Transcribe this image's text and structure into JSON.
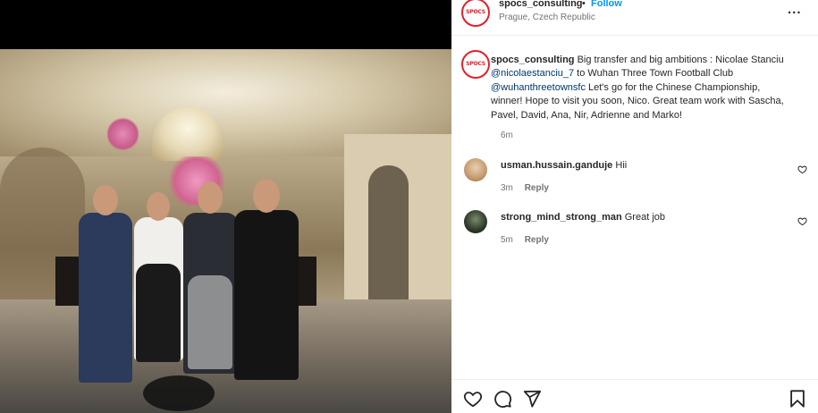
{
  "header": {
    "username": "spocs_consulting",
    "separator": "•",
    "follow_label": "Follow",
    "location": "Prague, Czech Republic",
    "more_label": "...",
    "avatar_text": "SPOCS"
  },
  "caption": {
    "username": "spocs_consulting",
    "text_1": " Big transfer and big ambitions : Nicolae Stanciu ",
    "mention_1": "@nicolaestanciu_7",
    "text_2": " to Wuhan Three Town Football Club ",
    "mention_2": "@wuhanthreetownsfc",
    "text_3": " Let's go for the Chinese Championship, winner! Hope to visit you soon, Nico. Great team work with Sascha, Pavel, David, Ana, Nir, Adrienne and Marko!",
    "time": "6m"
  },
  "comments": [
    {
      "username": "usman.hussain.ganduje",
      "text": "Hii",
      "time": "3m",
      "reply_label": "Reply"
    },
    {
      "username": "strong_mind_strong_man",
      "text": "Great job",
      "time": "5m",
      "reply_label": "Reply"
    }
  ],
  "actions": {
    "like_icon": "heart-icon",
    "comment_icon": "comment-icon",
    "share_icon": "share-icon",
    "save_icon": "bookmark-icon"
  },
  "colors": {
    "follow": "#0095f6",
    "mention": "#00376b",
    "brand": "#e2202c"
  }
}
